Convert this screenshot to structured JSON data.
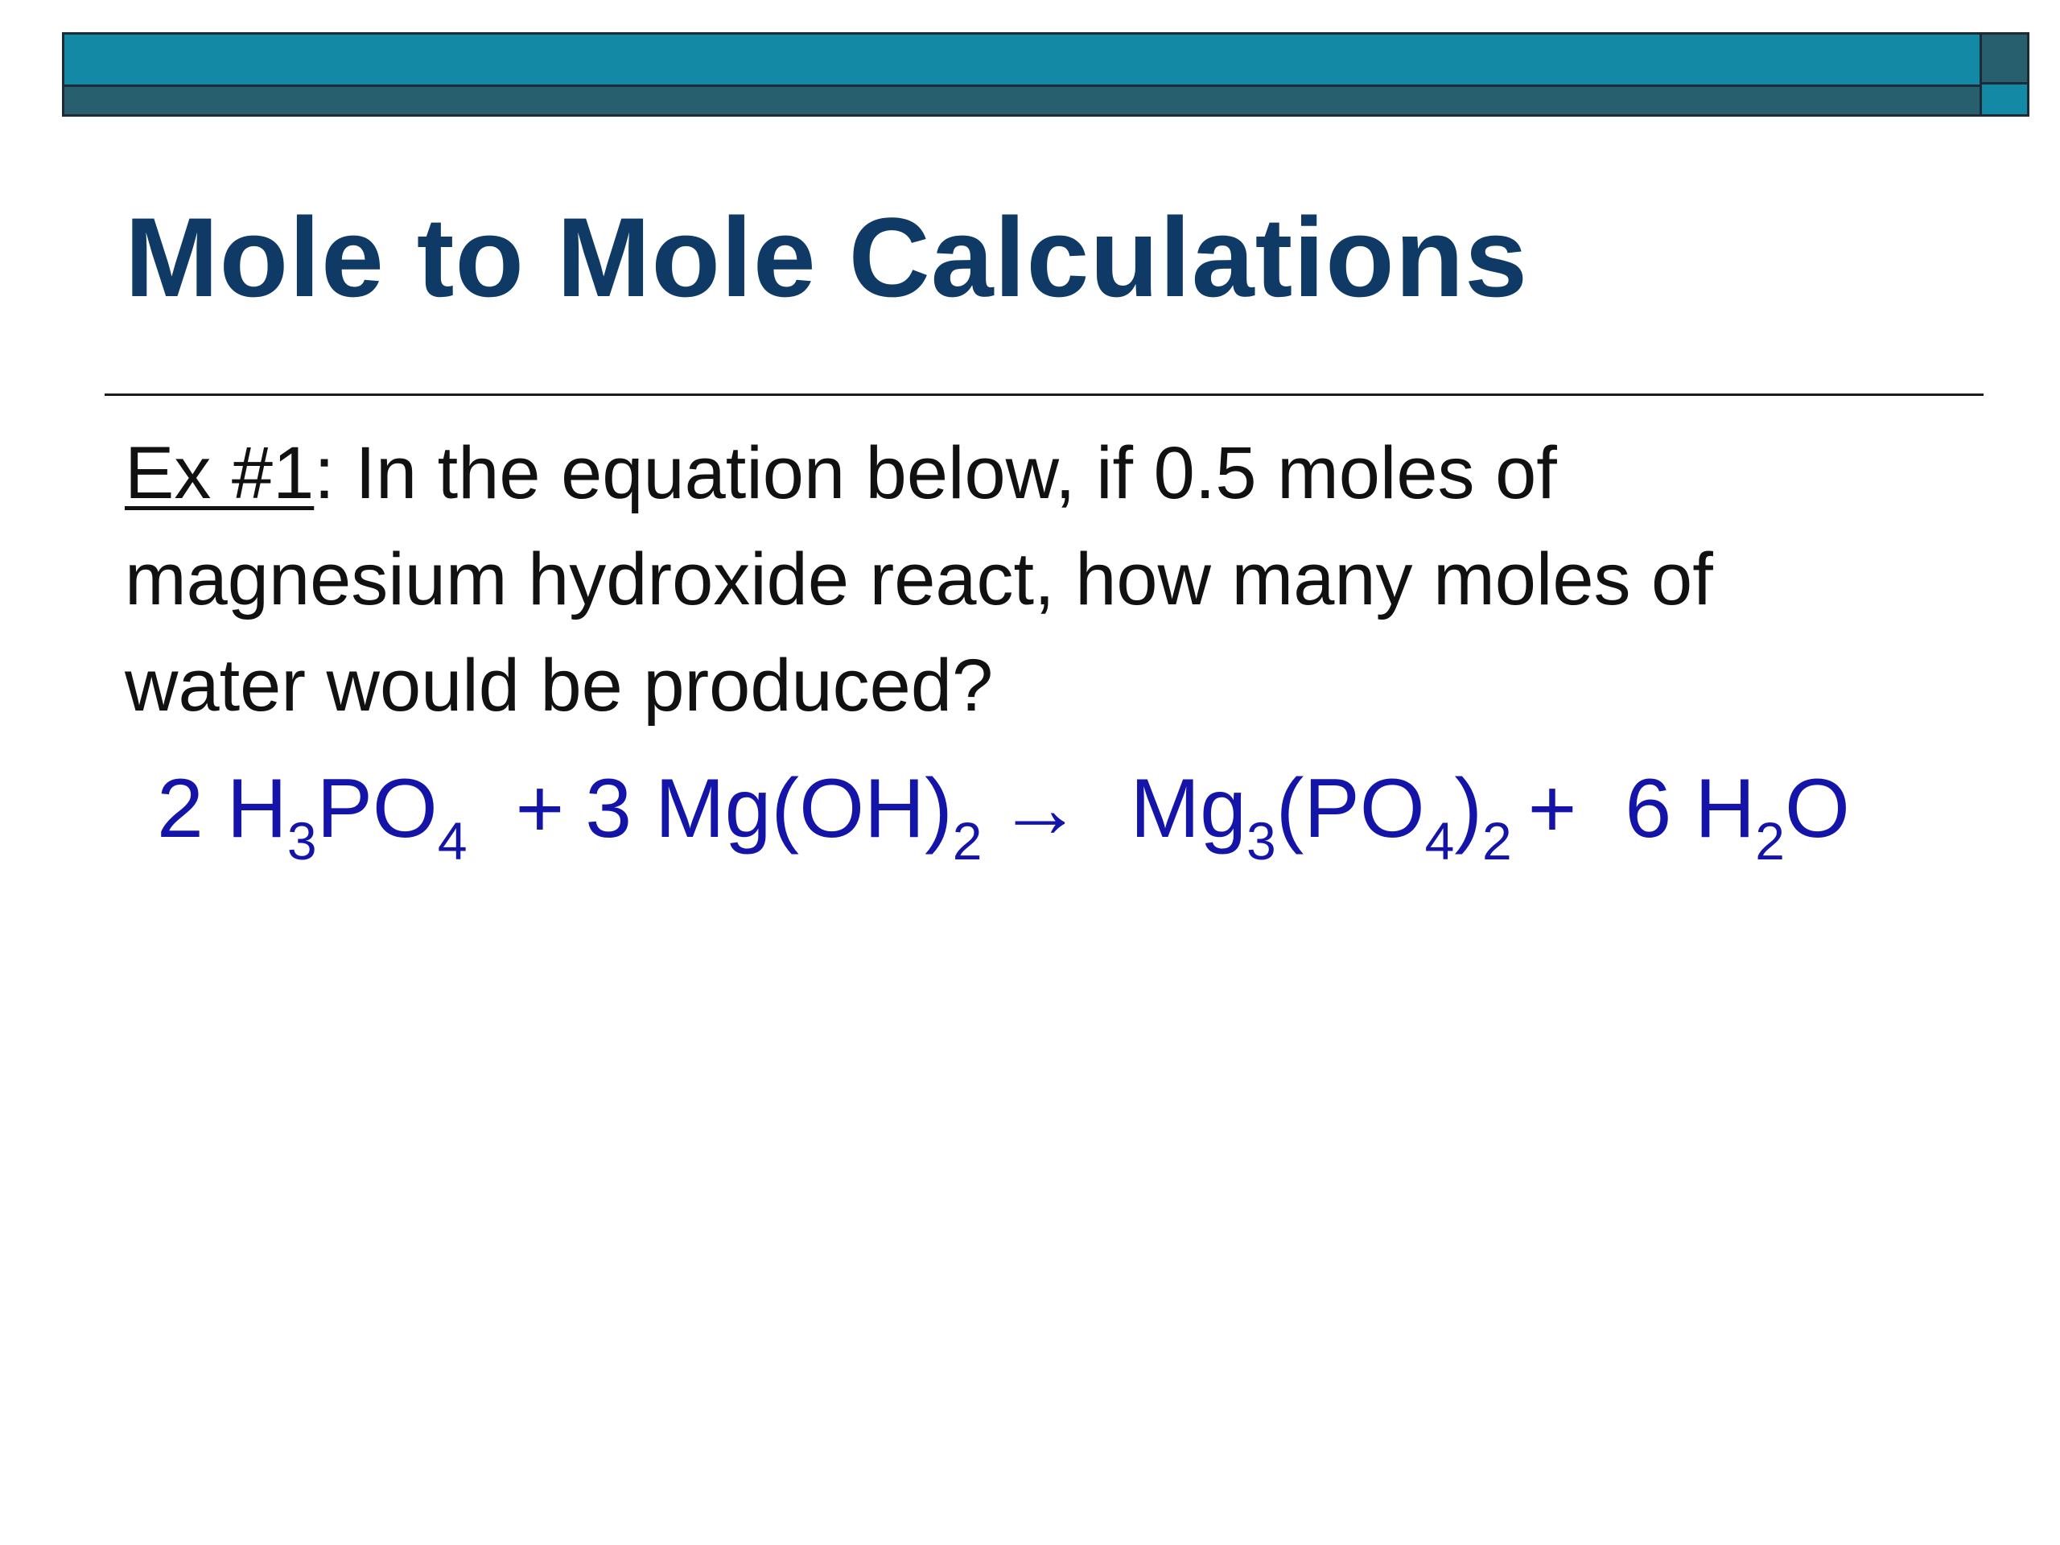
{
  "slide": {
    "title": "Mole to Mole Calculations",
    "question": {
      "label": "Ex #1",
      "separator": ":",
      "line1": " In the equation below, if 0.5 moles of",
      "line2": "magnesium hydroxide react, how many moles of",
      "line3": "water would be produced?"
    },
    "equation": {
      "reactant1": {
        "coef": "2 H",
        "sub1": "3",
        "mid": "PO",
        "sub2": "4"
      },
      "plus1": "+",
      "reactant2": {
        "coef": "3 Mg(OH)",
        "sub1": "2"
      },
      "arrow": "→",
      "product1": {
        "pre": "Mg",
        "sub1": "3",
        "mid": "(PO",
        "sub2": "4",
        "post": ")",
        "sub3": "2"
      },
      "plus2": "+",
      "product2": {
        "coef": "6 H",
        "sub1": "2",
        "post": "O"
      }
    },
    "colors": {
      "header_light": "#1389a6",
      "header_dark": "#275f6f",
      "title": "#0f3a66",
      "equation": "#1414a8",
      "text": "#111111"
    }
  }
}
